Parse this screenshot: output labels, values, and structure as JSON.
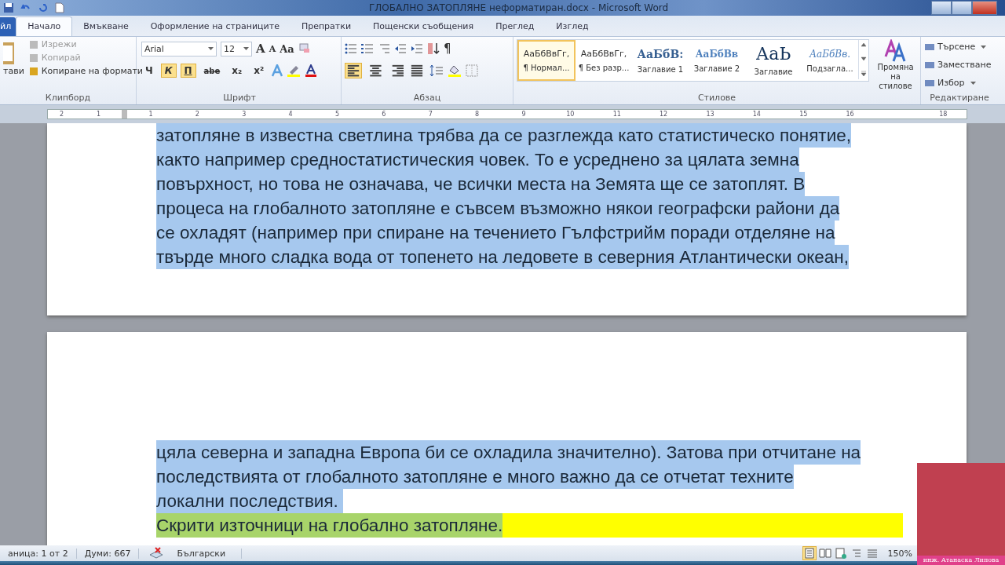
{
  "window": {
    "title": "ГЛОБАЛНО ЗАТОПЛЯНЕ неформатиран.docx  -  Microsoft Word"
  },
  "tabs": [
    {
      "label": "йл",
      "kind": "file",
      "selected": false
    },
    {
      "label": "Начало",
      "kind": "tab",
      "selected": true
    },
    {
      "label": "Вмъкване",
      "kind": "tab",
      "selected": false
    },
    {
      "label": "Оформление на страниците",
      "kind": "tab",
      "selected": false
    },
    {
      "label": "Препратки",
      "kind": "tab",
      "selected": false
    },
    {
      "label": "Пощенски съобщения",
      "kind": "tab",
      "selected": false
    },
    {
      "label": "Преглед",
      "kind": "tab",
      "selected": false
    },
    {
      "label": "Изглед",
      "kind": "tab",
      "selected": false
    }
  ],
  "clipboard": {
    "paste_label": "тави",
    "items": [
      {
        "label": "Изрежи",
        "disabled": true
      },
      {
        "label": "Копирай",
        "disabled": true
      },
      {
        "label": "Копиране на формати",
        "disabled": false
      }
    ],
    "group_label": "Клипборд"
  },
  "font": {
    "font_name": "Arial",
    "font_size": "12",
    "grow": "A",
    "shrink": "A",
    "case": "Aa",
    "buttons": [
      {
        "label": "Ч",
        "kind": "bold",
        "selected": false
      },
      {
        "label": "К",
        "kind": "italic",
        "selected": true
      },
      {
        "label": "П",
        "kind": "underline",
        "selected": true
      },
      {
        "label": "abe",
        "kind": "strike",
        "selected": false
      },
      {
        "label": "x₂",
        "kind": "plain",
        "selected": false
      },
      {
        "label": "x²",
        "kind": "plain",
        "selected": false
      }
    ],
    "group_label": "Шрифт"
  },
  "paragraph": {
    "pilcrow": "¶",
    "align": [
      {
        "kind": "left",
        "selected": true
      },
      {
        "kind": "center",
        "selected": false
      },
      {
        "kind": "right",
        "selected": false
      },
      {
        "kind": "justify",
        "selected": false
      }
    ],
    "group_label": "Абзац"
  },
  "styles": {
    "items": [
      {
        "preview": "АаБбВвГг,",
        "name": "¶ Нормал...",
        "kind": "normal",
        "selected": true
      },
      {
        "preview": "АаБбВвГг,",
        "name": "¶ Без разр...",
        "kind": "normal",
        "selected": false
      },
      {
        "preview": "АаБбВ:",
        "name": "Заглавие 1",
        "kind": "h1",
        "selected": false
      },
      {
        "preview": "АаБбВв",
        "name": "Заглавие 2",
        "kind": "h2",
        "selected": false
      },
      {
        "preview": "АаЬ",
        "name": "Заглавие",
        "kind": "title",
        "selected": false
      },
      {
        "preview": "АаБбВв.",
        "name": "Подзагла...",
        "kind": "subtitle",
        "selected": false
      }
    ],
    "change_styles": "Промяна на стилове",
    "group_label": "Стилове"
  },
  "editing": {
    "items": [
      {
        "label": "Търсене",
        "dropdown": true
      },
      {
        "label": "Заместване",
        "dropdown": false
      },
      {
        "label": "Избор",
        "dropdown": true
      }
    ],
    "group_label": "Редактиране"
  },
  "ruler": {
    "left_numbers": [
      "2",
      "1"
    ],
    "numbers": [
      "1",
      "2",
      "3",
      "4",
      "5",
      "6",
      "7",
      "8",
      "9",
      "10",
      "11",
      "12",
      "13",
      "14",
      "15",
      "16"
    ],
    "right_numbers": [
      "18"
    ]
  },
  "pages": [
    {
      "lines": [
        {
          "text": "затопляне в известна светлина трябва да се разглежда като статистическо понятие,",
          "kind": "text",
          "selected": true
        },
        {
          "text": "както например средностатистическия човек. То е усреднено за цялата земна",
          "kind": "text",
          "selected": true
        },
        {
          "text": "повърхност, но това не означава, че всички места на Земята ще се затоплят. В",
          "kind": "text",
          "selected": true
        },
        {
          "text": "процеса на глобалното затопляне е съвсем възможно някои географски райони да",
          "kind": "text",
          "selected": true
        },
        {
          "text": "се охладят (например при спиране на течението Гълфстрийм поради отделяне на",
          "kind": "text",
          "selected": true
        },
        {
          "text": "твърде много сладка вода от топенето на ледовете в северния Атлантически океан,",
          "kind": "text",
          "selected": true
        }
      ]
    },
    {
      "lines": [
        {
          "text": "цяла северна и западна Европа би се охладила значително). Затова при отчитане на",
          "kind": "text",
          "selected": true
        },
        {
          "text": "последствията от глобалното затопляне е много важно да се отчетат техните",
          "kind": "text",
          "selected": true
        },
        {
          "text": "локални последствия. ",
          "kind": "text",
          "selected": true
        },
        {
          "text": "Скрити източници на глобално затопляне.",
          "kind": "heading",
          "selected": true
        }
      ]
    }
  ],
  "status_bar": {
    "page": "аница: 1 от 2",
    "words": "Думи: 667",
    "language": "Български",
    "zoom": "150%",
    "views": [
      {
        "kind": "print",
        "selected": true
      },
      {
        "kind": "reading",
        "selected": false
      },
      {
        "kind": "web",
        "selected": false
      },
      {
        "kind": "outline",
        "selected": false
      },
      {
        "kind": "draft",
        "selected": false
      }
    ]
  },
  "presenter": {
    "caption": "инж. Атанаска Липова"
  }
}
